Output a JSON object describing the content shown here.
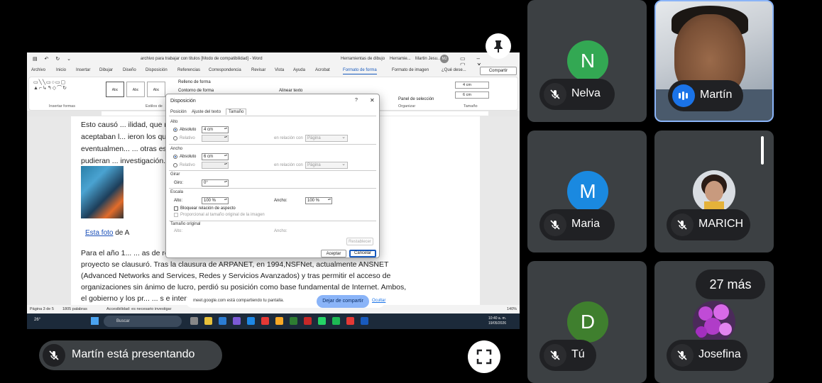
{
  "colors": {
    "nelva_avatar": "#33a853",
    "maria_avatar": "#1a89e0",
    "tu_avatar": "#3f7f2e",
    "stop_share": "#8ab4f8",
    "speaking": "#1a73e8"
  },
  "word": {
    "doc_title": "archivo para trabajar con titulos [Modo de compatibilidad] - Word",
    "tools1": "Herramientas de dibujo",
    "tools2": "Herramie...",
    "user": "Martin Jesu...",
    "user_initials": "MJ",
    "tabs": [
      "Archivo",
      "Inicio",
      "Insertar",
      "Dibujar",
      "Diseño",
      "Disposición",
      "Referencias",
      "Correspondencia",
      "Revisar",
      "Vista",
      "Ayuda",
      "Acrobat",
      "Formato de forma",
      "Formato de imagen",
      "¿Qué dese..."
    ],
    "share": "Compartir",
    "ribbon": {
      "insert_shapes": "Insertar formas",
      "styles": "Estilos de",
      "style_label": "Abc",
      "fill": "Relleno de forma",
      "outline": "Contorno de forma",
      "align_text": "Alinear texto",
      "selection_pane": "Panel de selección",
      "organize": "Organizar",
      "size": "Tamaño",
      "height": "4 cm",
      "width": "6 cm"
    },
    "paragraphs": [
      "Esto causó ... ilidad, que no",
      "aceptaban l... ieron los que",
      "eventualmen... ... otras escuelas",
      "pudieran ... investigación.",
      "Para el año 1... ... as de red, y el",
      "proyecto se clausuró. Tras la clausura de ARPANET, en 1994,NSFNet, actualmente ANSNET",
      "(Advanced Networks and Services, Redes y Servicios Avanzados) y tras permitir el acceso de",
      "organizaciones sin ánimo de lucro, perdió su posición como base fundamental de Internet. Ambos,",
      "el gobierno y los pr... ... s e interconexiones."
    ],
    "caption_link": "Esta foto",
    "caption_rest": " de A",
    "status": {
      "page": "Página 3 de 5",
      "words": "1805 palabras",
      "accessibility": "Accesibilidad: es necesario investigar",
      "zoom": "140%"
    }
  },
  "dialog": {
    "title": "Disposición",
    "help": "?",
    "close": "✕",
    "tabs": [
      "Posición",
      "Ajuste del texto",
      "Tamaño"
    ],
    "alto": "Alto",
    "ancho": "Ancho",
    "absoluto": "Absoluto",
    "relativo": "Relativo",
    "alto_value": "4 cm",
    "ancho_value": "6 cm",
    "en_relacion": "en relación con",
    "pagina": "Página",
    "girar": "Girar",
    "giro": "Giro:",
    "giro_value": "0°",
    "escala": "Escala",
    "alto_scale": "Alto:",
    "ancho_scale": "Ancho:",
    "scale_value": "100 %",
    "lock_ratio": "Bloquear relación de aspecto",
    "proportional": "Proporcional al tamaño original de la imagen",
    "original_size": "Tamaño original",
    "orig_alto": "Alto:",
    "orig_ancho": "Ancho:",
    "reset": "Restablecer",
    "ok": "Aceptar",
    "cancel": "Cancelar"
  },
  "taskbar": {
    "temp": "26°",
    "search": "Buscar",
    "time": "10:40 a. m.",
    "date": "19/05/2026"
  },
  "share_bar": {
    "text": "meet.google.com está compartiendo tu pantalla.",
    "stop": "Dejar de compartir",
    "hide": "Ocultar"
  },
  "presenter": "Martín está presentando",
  "participants": {
    "nelva": {
      "initial": "N",
      "name": "Nelva"
    },
    "martin": {
      "name": "Martín"
    },
    "maria": {
      "initial": "M",
      "name": "Maria"
    },
    "marich": {
      "name": "MARICH"
    },
    "tu": {
      "initial": "D",
      "name": "Tú"
    },
    "josefina": {
      "name": "Josefina"
    },
    "more": "27 más"
  },
  "icons": [
    "pin-icon",
    "fullscreen-icon",
    "mic-off-icon",
    "speaking-icon",
    "search-icon",
    "windows-icon"
  ]
}
